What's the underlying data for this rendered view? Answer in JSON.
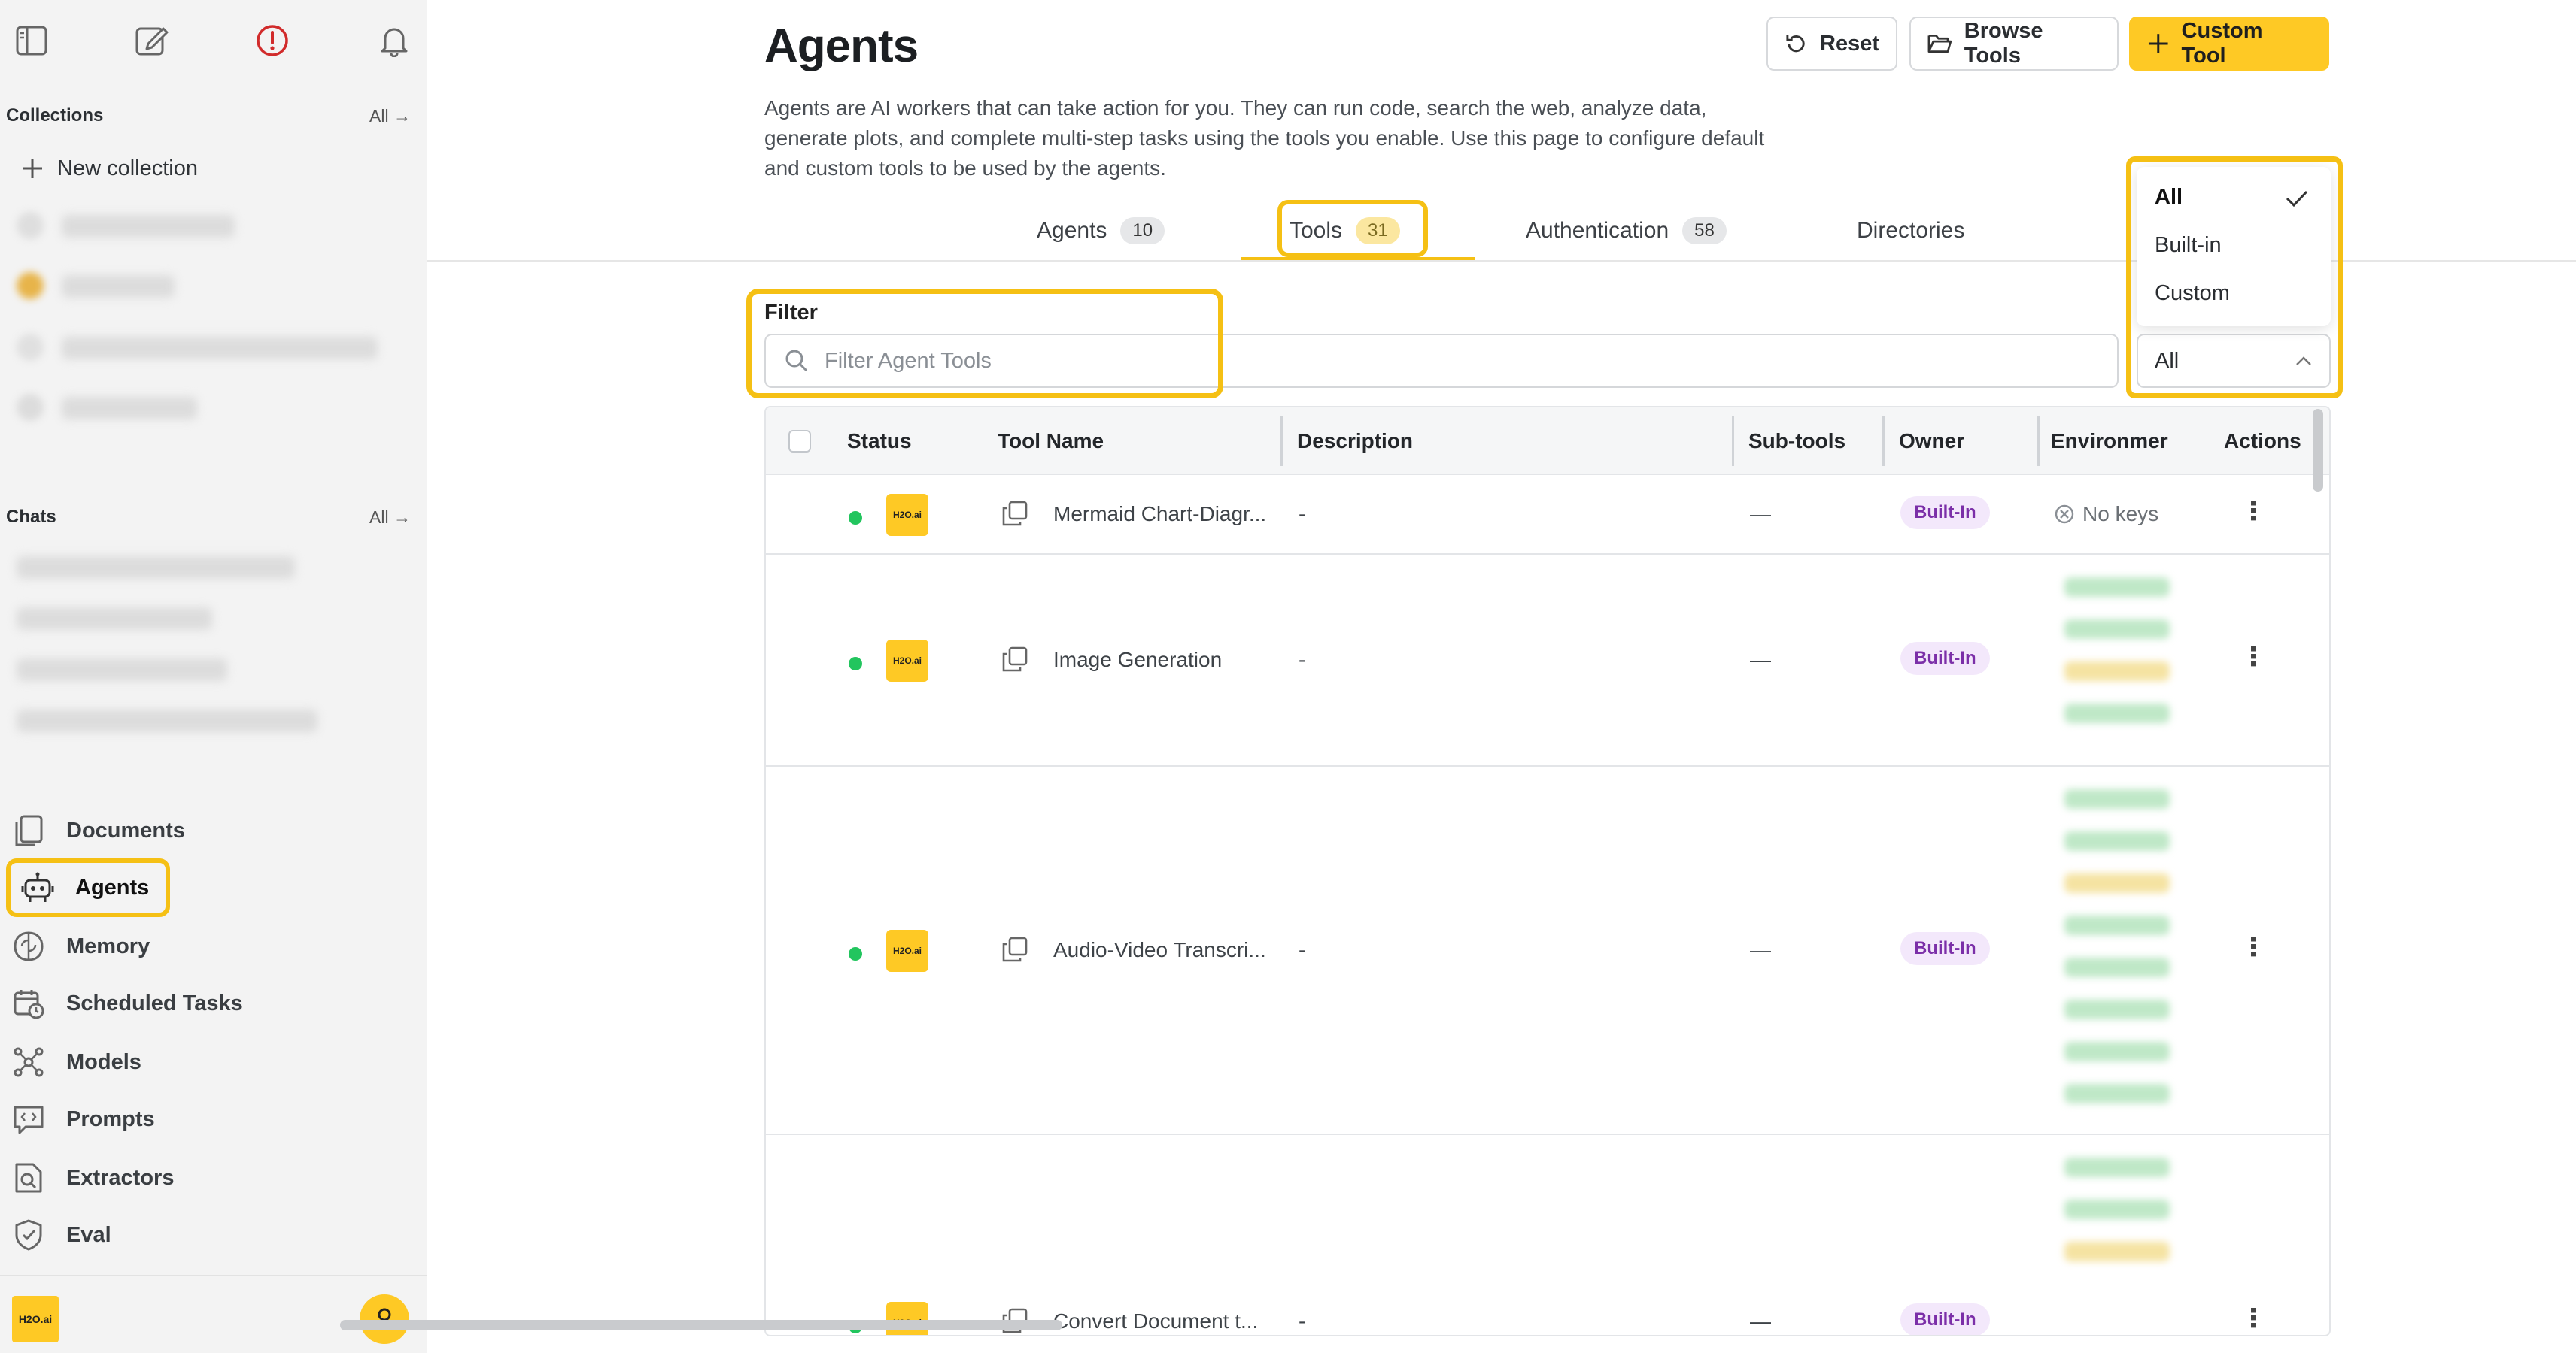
{
  "sidebar": {
    "collections_label": "Collections",
    "collections_all": "All →",
    "new_collection": "New collection",
    "chats_label": "Chats",
    "chats_all": "All →",
    "nav": [
      {
        "label": "Documents",
        "icon": "documents-icon"
      },
      {
        "label": "Agents",
        "icon": "agent-robot-icon"
      },
      {
        "label": "Memory",
        "icon": "brain-icon"
      },
      {
        "label": "Scheduled Tasks",
        "icon": "calendar-clock-icon"
      },
      {
        "label": "Models",
        "icon": "model-graph-icon"
      },
      {
        "label": "Prompts",
        "icon": "prompt-code-icon"
      },
      {
        "label": "Extractors",
        "icon": "extract-search-icon"
      },
      {
        "label": "Eval",
        "icon": "shield-check-icon"
      }
    ],
    "logo_text": "H2O.ai"
  },
  "header": {
    "title": "Agents",
    "description": "Agents are AI workers that can take action for you. They can run code, search the web, analyze data, generate plots, and complete multi-step tasks using the tools you enable. Use this page to configure default and custom tools to be used by the agents.",
    "reset_label": "Reset",
    "browse_label": "Browse Tools",
    "custom_label": "Custom Tool"
  },
  "tabs": [
    {
      "label": "Agents",
      "count": "10"
    },
    {
      "label": "Tools",
      "count": "31"
    },
    {
      "label": "Authentication",
      "count": "58"
    },
    {
      "label": "Directories",
      "count": ""
    }
  ],
  "filter": {
    "label": "Filter",
    "placeholder": "Filter Agent Tools",
    "select_value": "All",
    "options": [
      "All",
      "Built-in",
      "Custom"
    ]
  },
  "table": {
    "headers": [
      "Status",
      "Tool Name",
      "Description",
      "Sub-tools",
      "Owner",
      "Environmer",
      "Actions"
    ],
    "rows": [
      {
        "name": "Mermaid Chart-Diagr...",
        "description": "-",
        "subtools": "—",
        "owner": "Built-In",
        "env": "No keys"
      },
      {
        "name": "Image Generation",
        "description": "-",
        "subtools": "—",
        "owner": "Built-In",
        "env": ""
      },
      {
        "name": "Audio-Video Transcri...",
        "description": "-",
        "subtools": "—",
        "owner": "Built-In",
        "env": ""
      },
      {
        "name": "Convert Document t...",
        "description": "-",
        "subtools": "—",
        "owner": "Built-In",
        "env": ""
      }
    ]
  },
  "colors": {
    "accent": "#f5c014",
    "brand_yellow": "#fec925",
    "status_green": "#22c55e",
    "owner_purple": "#7b2fa8"
  }
}
